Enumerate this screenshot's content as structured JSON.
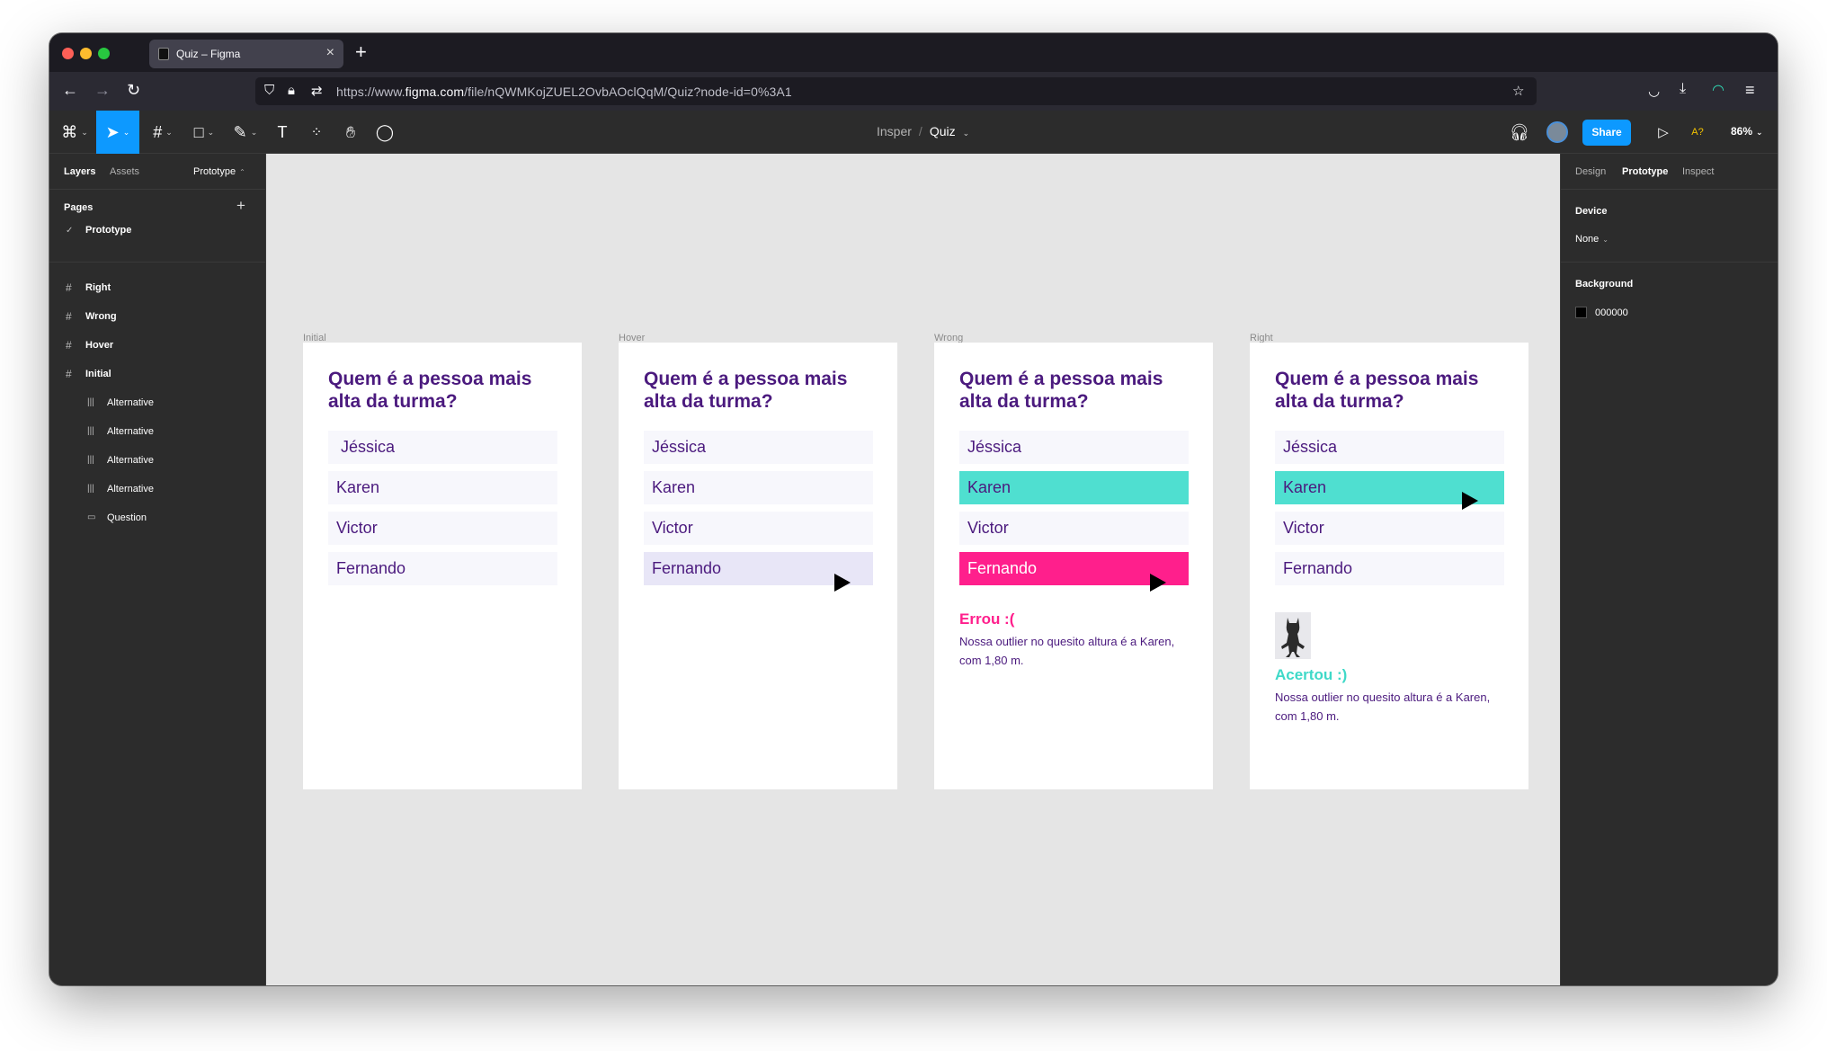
{
  "browser": {
    "tab_title": "Quiz – Figma",
    "tab_close": "×",
    "new_tab": "+",
    "url_prefix": "https://www.",
    "url_domain": "figma.com",
    "url_path": "/file/nQWMKojZUEL2OvbAOclQqM/Quiz?node-id=0%3A1"
  },
  "toolbar": {
    "breadcrumb_team": "Insper",
    "breadcrumb_sep": "/",
    "file_name": "Quiz",
    "share_label": "Share",
    "zoom": "86%",
    "text_tool": "T",
    "a_label": "A?"
  },
  "left_panel": {
    "tabs": [
      "Layers",
      "Assets"
    ],
    "page_selector": "Prototype",
    "pages_heading": "Pages",
    "pages_add": "+",
    "current_page": "Prototype",
    "layers": [
      {
        "label": "Right",
        "kind": "frame"
      },
      {
        "label": "Wrong",
        "kind": "frame"
      },
      {
        "label": "Hover",
        "kind": "frame"
      },
      {
        "label": "Initial",
        "kind": "frame"
      },
      {
        "label": "Alternative",
        "kind": "component"
      },
      {
        "label": "Alternative",
        "kind": "component"
      },
      {
        "label": "Alternative",
        "kind": "component"
      },
      {
        "label": "Alternative",
        "kind": "component"
      },
      {
        "label": "Question",
        "kind": "text"
      }
    ]
  },
  "frames": [
    {
      "label": "Initial",
      "question": "Quem é a pessoa mais alta da turma?",
      "alternatives": [
        "Jéssica",
        "Karen",
        "Victor",
        "Fernando"
      ]
    },
    {
      "label": "Hover",
      "question": "Quem é a pessoa mais alta da turma?",
      "alternatives": [
        "Jéssica",
        "Karen",
        "Victor",
        "Fernando"
      ]
    },
    {
      "label": "Wrong",
      "question": "Quem é a pessoa mais alta da turma?",
      "alternatives": [
        "Jéssica",
        "Karen",
        "Victor",
        "Fernando"
      ],
      "feedback_title": "Errou :(",
      "feedback_text": "Nossa outlier no quesito altura é a Karen, com 1,80 m."
    },
    {
      "label": "Right",
      "question": "Quem é a pessoa mais alta da turma?",
      "alternatives": [
        "Jéssica",
        "Karen",
        "Victor",
        "Fernando"
      ],
      "feedback_title": "Acertou :)",
      "feedback_text": "Nossa outlier no quesito altura é a Karen, com 1,80 m."
    }
  ],
  "right_panel": {
    "tabs": [
      "Design",
      "Prototype",
      "Inspect"
    ],
    "device_heading": "Device",
    "device_value": "None",
    "background_heading": "Background",
    "background_value": "000000"
  },
  "help_label": "?",
  "colors": {
    "accent": "#0d99ff",
    "question_purple": "#4b1a7e",
    "right_teal": "#4fdfd0",
    "wrong_pink": "#ff1f8c",
    "canvas": "#e5e5e5"
  }
}
